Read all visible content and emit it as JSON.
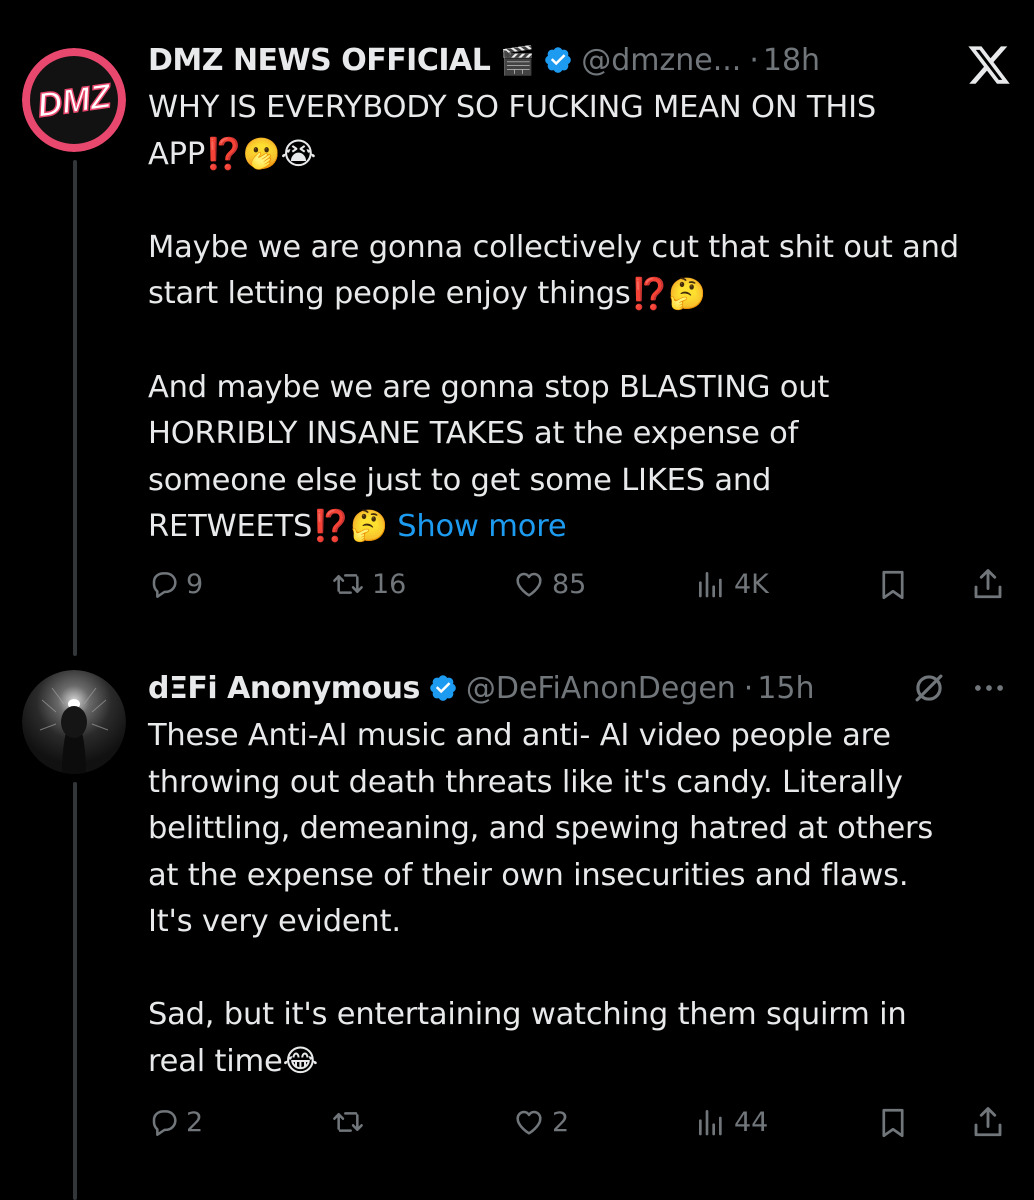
{
  "colors": {
    "background": "#000000",
    "text": "#e7e9ea",
    "muted": "#71767b",
    "link": "#1d9bf0",
    "verified": "#1d9bf0",
    "avatar_ring": "#e8486e"
  },
  "tweet1": {
    "avatar_text": "DMZ",
    "display_name": "DMZ NEWS OFFICIAL",
    "name_emoji": "🎬",
    "handle": "@dmzne...",
    "sep": "·",
    "time": "18h",
    "lines": {
      "l1": "WHY IS EVERYBODY SO FUCKING MEAN ON THIS",
      "l2": "APP",
      "l2_emoji": "⁉️🫢😭",
      "p2_l1": "Maybe we are gonna collectively cut that shit out and",
      "p2_l2": "start letting people enjoy things",
      "p2_l2_emoji": "⁉️🤔",
      "p3_l1": "And maybe we are gonna stop BLASTING out",
      "p3_l2": "HORRIBLY INSANE TAKES at the expense of",
      "p3_l3": "someone else just to get some LIKES and",
      "p3_l4": "RETWEETS",
      "p3_l4_emoji": "⁉️🤔"
    },
    "show_more": "Show more",
    "actions": {
      "replies": "9",
      "retweets": "16",
      "likes": "85",
      "views": "4K"
    }
  },
  "tweet2": {
    "display_name": "dΞFi Anonymous",
    "handle": "@DeFiAnonDegen",
    "sep": "·",
    "time": "15h",
    "lines": {
      "l1": "These Anti-AI music and anti- AI video people are",
      "l2": "throwing out death threats like it's candy. Literally",
      "l3": "belittling, demeaning, and spewing hatred at others",
      "l4": "at the expense of their own insecurities and flaws.",
      "l5": "It's very evident.",
      "p2_l1": "Sad, but it's entertaining watching them squirm in",
      "p2_l2": "real time",
      "p2_l2_emoji": "😂"
    },
    "actions": {
      "replies": "2",
      "retweets": "",
      "likes": "2",
      "views": "44"
    }
  }
}
